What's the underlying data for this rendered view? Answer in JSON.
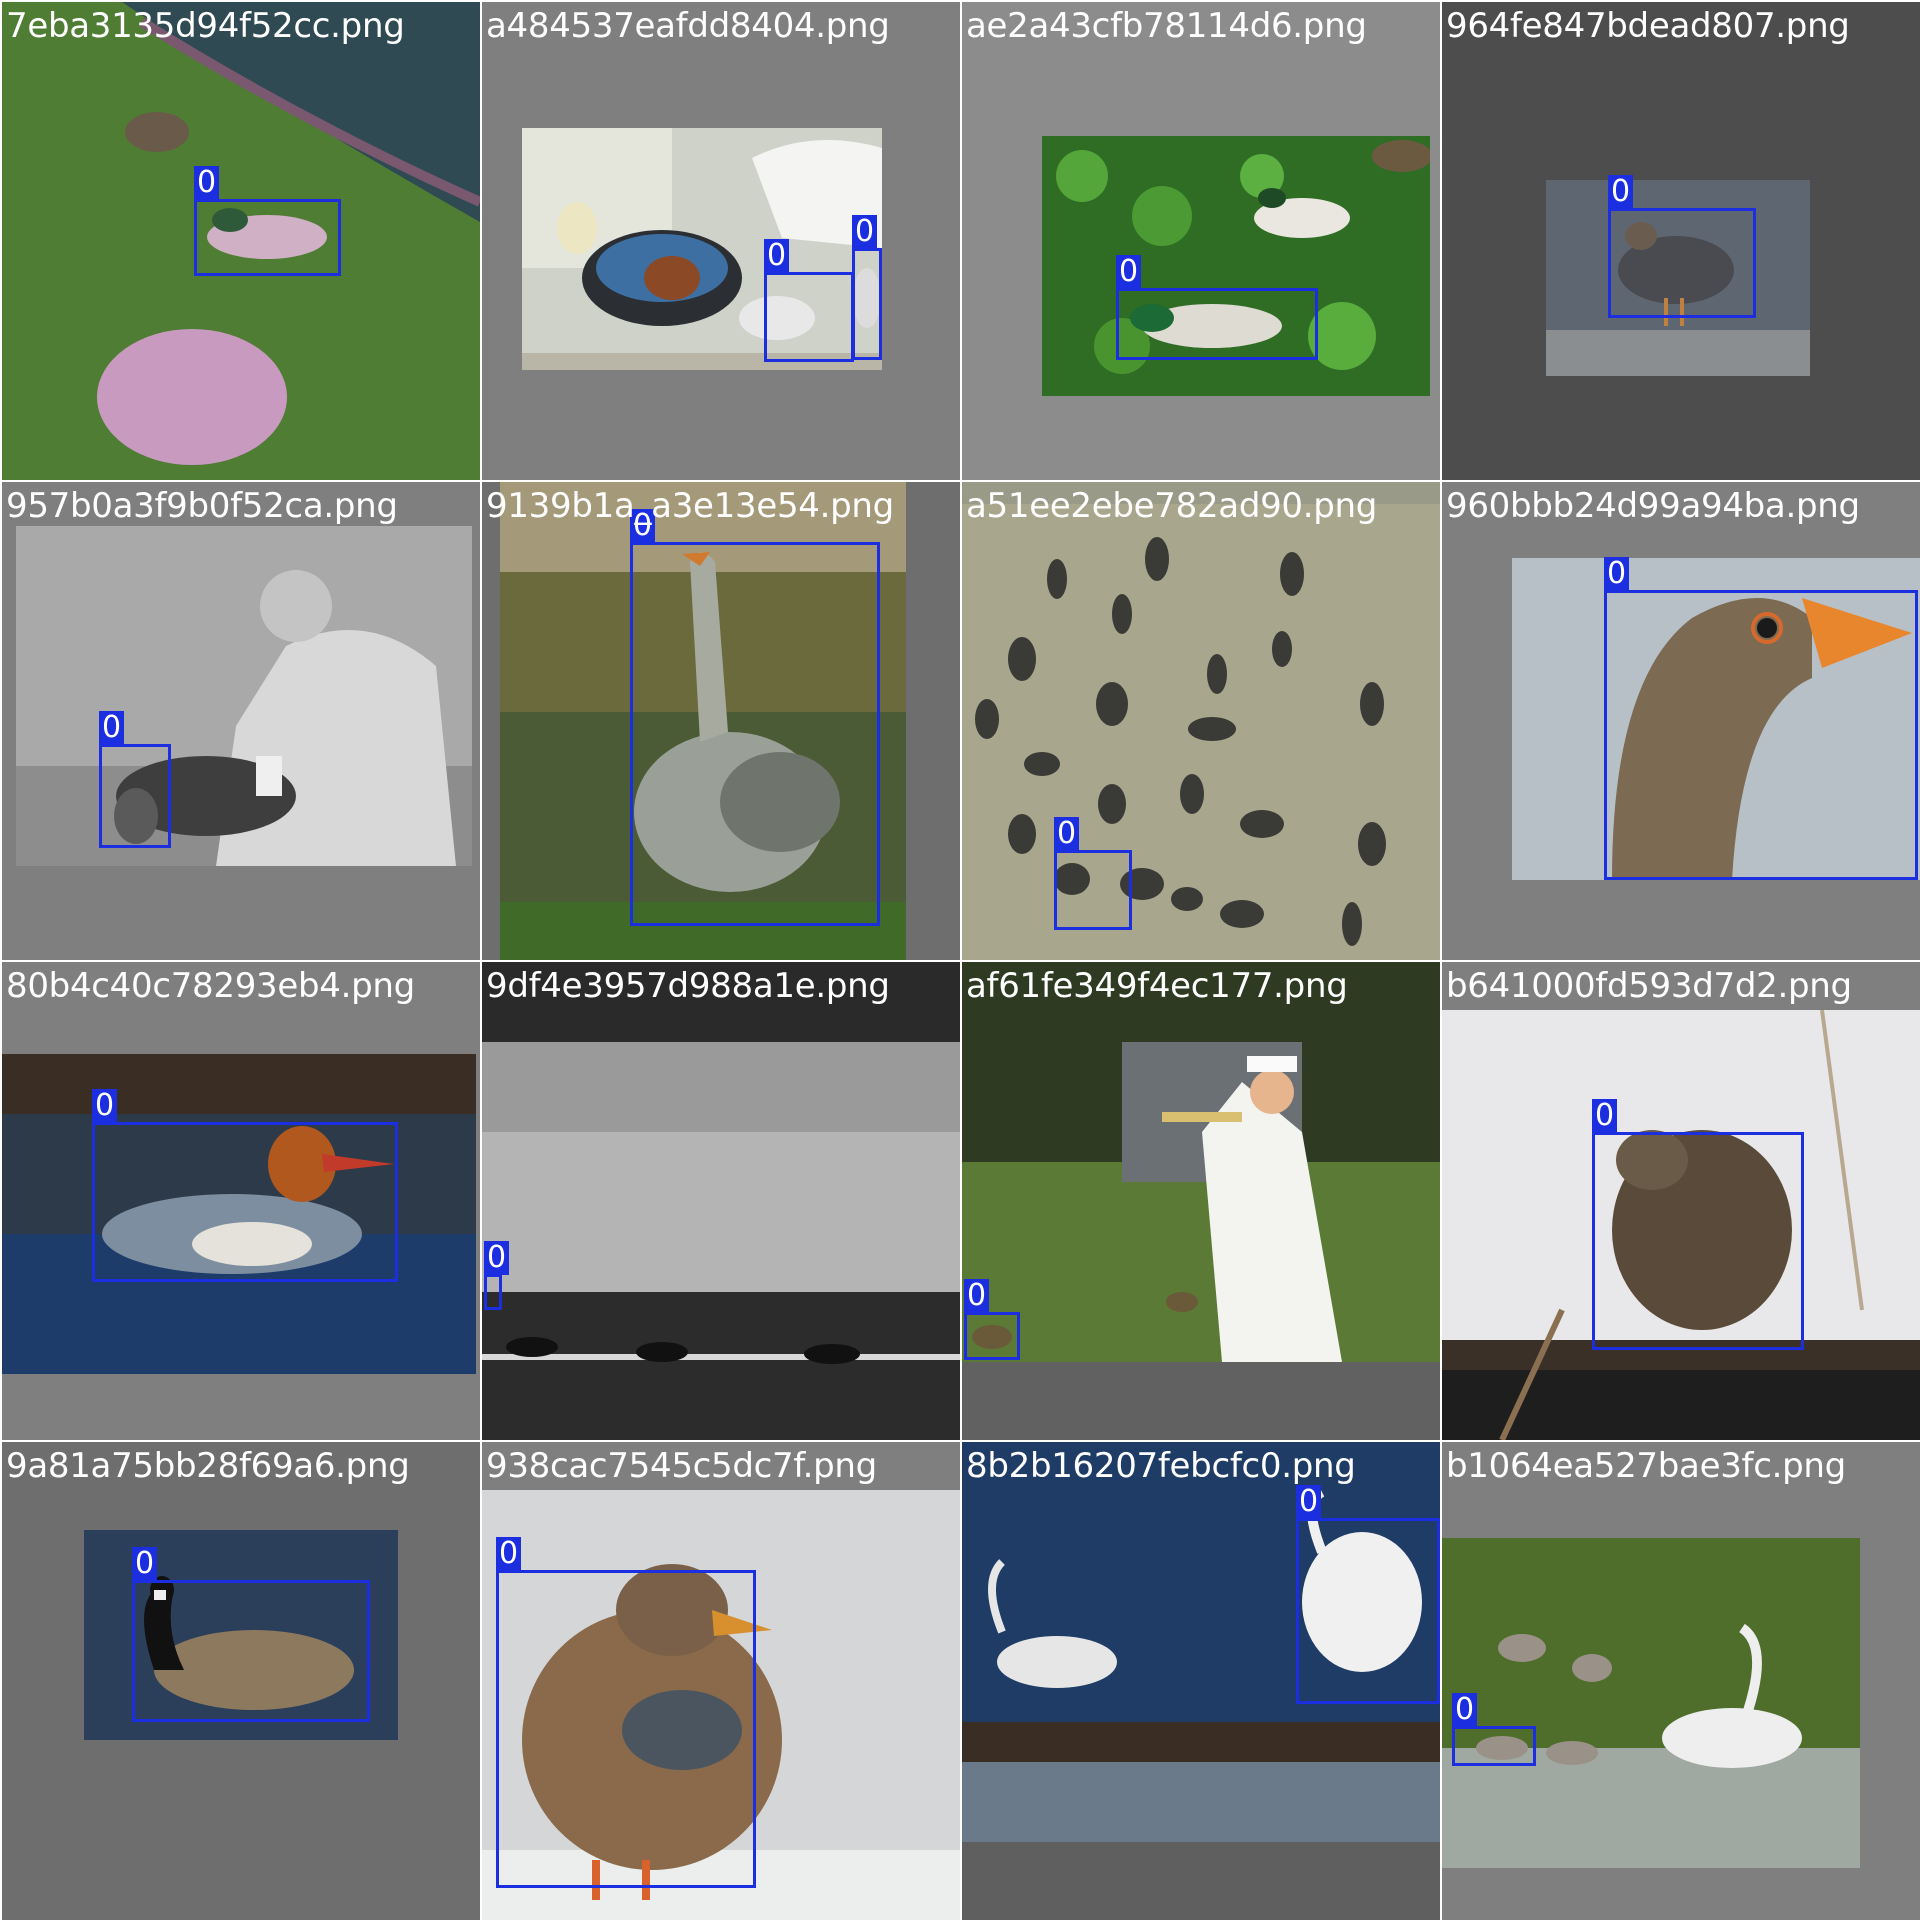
{
  "mosaic": {
    "colors": {
      "box": "#1b2fe0",
      "label_text": "#ffffff"
    },
    "tiles": [
      {
        "filename": "7eba3135d94f52cc.png",
        "subject": "mallard drake on grass",
        "labels": [
          "0"
        ]
      },
      {
        "filename": "a484537eafdd8404.png",
        "subject": "ducks and chicken near water bowl",
        "labels": [
          "0",
          "0"
        ]
      },
      {
        "filename": "ae2a43cfb78114d6.png",
        "subject": "mallards on duckweed pond",
        "labels": [
          "0"
        ]
      },
      {
        "filename": "964fe847bdead807.png",
        "subject": "duck on pavement",
        "labels": [
          "0"
        ]
      },
      {
        "filename": "957b0a3f9b0f52ca.png",
        "subject": "man sitting with duck (black and white)",
        "labels": [
          "0"
        ]
      },
      {
        "filename": "9139b1a_a3e13e54.png",
        "subject": "grey goose at pond edge",
        "labels": [
          "0"
        ]
      },
      {
        "filename": "a51ee2ebe782ad90.png",
        "subject": "flock of black swans on water",
        "labels": [
          "0"
        ]
      },
      {
        "filename": "960bbb24d99a94ba.png",
        "subject": "greylag goose head close-up",
        "labels": [
          "0"
        ]
      },
      {
        "filename": "80b4c40c78293eb4.png",
        "subject": "merganser swimming",
        "labels": [
          "0"
        ]
      },
      {
        "filename": "9df4e3957d988a1e.png",
        "subject": "geese on lake (black and white)",
        "labels": [
          "0"
        ]
      },
      {
        "filename": "af61fe349f4ec177.png",
        "subject": "sailor playing trumpet near ducklings",
        "labels": [
          "0"
        ]
      },
      {
        "filename": "b641000fd593d7d2.png",
        "subject": "duck perched on log",
        "labels": [
          "0"
        ]
      },
      {
        "filename": "9a81a75bb28f69a6.png",
        "subject": "canada goose swimming",
        "labels": [
          "0"
        ]
      },
      {
        "filename": "938cac7545c5dc7f.png",
        "subject": "female mallard standing",
        "labels": [
          "0"
        ]
      },
      {
        "filename": "8b2b16207febcfc0.png",
        "subject": "swans at shoreline",
        "labels": [
          "0"
        ]
      },
      {
        "filename": "b1064ea527bae3fc.png",
        "subject": "swan with cygnets",
        "labels": [
          "0"
        ]
      }
    ]
  }
}
